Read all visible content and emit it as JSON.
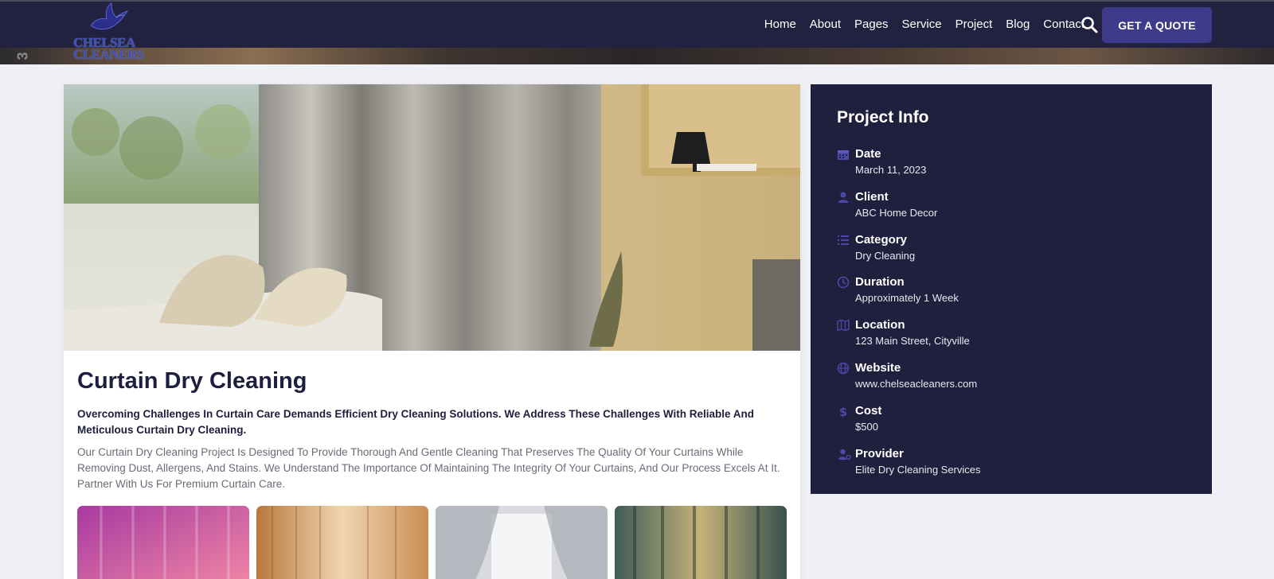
{
  "header": {
    "logo_line1": "CHELSEA",
    "logo_line2": "CLEANERS",
    "side_mark": "3",
    "nav": [
      "Home",
      "About",
      "Pages",
      "Service",
      "Project",
      "Blog",
      "Contact"
    ],
    "search_icon": "search-icon",
    "quote_label": "GET A QUOTE"
  },
  "project": {
    "title": "Curtain Dry Cleaning",
    "lead": "Overcoming Challenges In Curtain Care Demands Efficient Dry Cleaning Solutions. We Address These Challenges With Reliable And Meticulous Curtain Dry Cleaning.",
    "body": "Our Curtain Dry Cleaning Project Is Designed To Provide Thorough And Gentle Cleaning That Preserves The Quality Of Your Curtains While Removing Dust, Allergens, And Stains. We Understand The Importance Of Maintaining The Integrity Of Your Curtains, And Our Process Excels At It. Partner With Us For Premium Curtain Care."
  },
  "info": {
    "title": "Project Info",
    "items": [
      {
        "label": "Date",
        "value": "March 11, 2023",
        "icon": "calendar-icon"
      },
      {
        "label": "Client",
        "value": "ABC Home Decor",
        "icon": "user-icon"
      },
      {
        "label": "Category",
        "value": "Dry Cleaning",
        "icon": "list-icon"
      },
      {
        "label": "Duration",
        "value": "Approximately 1 Week",
        "icon": "clock-icon"
      },
      {
        "label": "Location",
        "value": "123 Main Street, Cityville",
        "icon": "map-icon"
      },
      {
        "label": "Website",
        "value": "www.chelseacleaners.com",
        "icon": "globe-icon"
      },
      {
        "label": "Cost",
        "value": "$500",
        "icon": "dollar-icon"
      },
      {
        "label": "Provider",
        "value": "Elite Dry Cleaning Services",
        "icon": "user-gear-icon"
      }
    ]
  },
  "colors": {
    "navy": "#222240",
    "accent": "#3d3b8a",
    "sidebar": "#20203e",
    "icon": "#4a48a8"
  }
}
